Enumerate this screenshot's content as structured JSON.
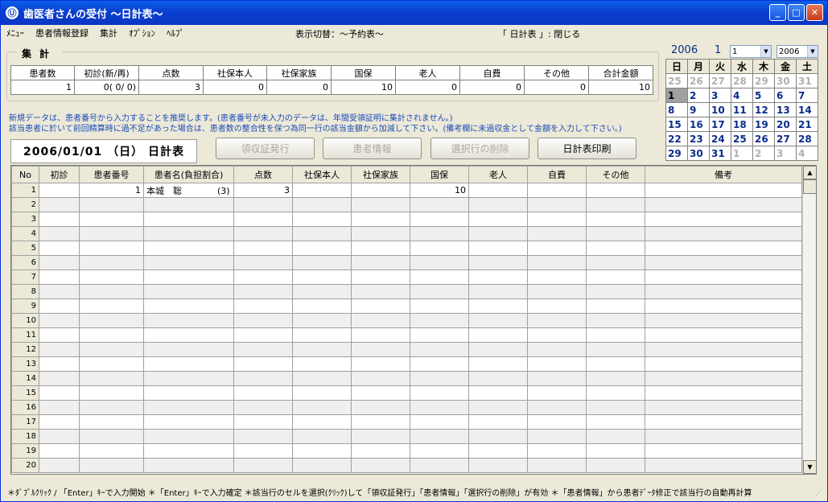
{
  "window": {
    "title": "歯医者さんの受付 ～日計表～",
    "app_icon": "Ⓤ"
  },
  "menu": {
    "items": [
      "ﾒﾆｭｰ",
      "患者情報登録",
      "集計",
      "ｵﾌﾟｼｮﾝ",
      "ﾍﾙﾌﾟ"
    ],
    "view_switch": "表示切替：～予約表～",
    "close_label": "「 日計表 」: 閉じる"
  },
  "summary": {
    "title": "集計",
    "headers": [
      "患者数",
      "初診(新/再)",
      "点数",
      "社保本人",
      "社保家族",
      "国保",
      "老人",
      "自費",
      "その他",
      "合計金額"
    ],
    "values": [
      "1",
      "0(  0/  0)",
      "3",
      "0",
      "0",
      "10",
      "0",
      "0",
      "0",
      "10"
    ]
  },
  "notes": [
    "新規データは、患者番号から入力することを推奨します。(患者番号が未入力のデータは、年間受領証明に集計されません。)",
    "該当患者に於いて前回精算時に過不足があった場合は、患者数の整合性を保つ為同一行の該当金額から加減して下さい。(備考欄に未過収金として金額を入力して下さい。)"
  ],
  "date_label": "2006/01/01 （日） 日計表",
  "buttons": {
    "receipt": "領収証発行",
    "patient_info": "患者情報",
    "delete_row": "選択行の削除",
    "print": "日計表印刷"
  },
  "calendar": {
    "year": "2006",
    "month": "1",
    "month_select": "1",
    "year_select": "2006",
    "weekdays": [
      "日",
      "月",
      "火",
      "水",
      "木",
      "金",
      "土"
    ],
    "weeks": [
      [
        "25",
        "26",
        "27",
        "28",
        "29",
        "30",
        "31"
      ],
      [
        "1",
        "2",
        "3",
        "4",
        "5",
        "6",
        "7"
      ],
      [
        "8",
        "9",
        "10",
        "11",
        "12",
        "13",
        "14"
      ],
      [
        "15",
        "16",
        "17",
        "18",
        "19",
        "20",
        "21"
      ],
      [
        "22",
        "23",
        "24",
        "25",
        "26",
        "27",
        "28"
      ],
      [
        "29",
        "30",
        "31",
        "1",
        "2",
        "3",
        "4"
      ]
    ]
  },
  "grid": {
    "headers": [
      "No",
      "初診",
      "患者番号",
      "患者名(負担割合)",
      "点数",
      "社保本人",
      "社保家族",
      "国保",
      "老人",
      "自費",
      "その他",
      "備考"
    ],
    "rows": [
      [
        "1",
        "",
        "1",
        "本城　聡　　　　(3)",
        "3",
        "",
        "",
        "10",
        "",
        "",
        "",
        ""
      ],
      [
        "2"
      ],
      [
        "3"
      ],
      [
        "4"
      ],
      [
        "5"
      ],
      [
        "6"
      ],
      [
        "7"
      ],
      [
        "8"
      ],
      [
        "9"
      ],
      [
        "10"
      ],
      [
        "11"
      ],
      [
        "12"
      ],
      [
        "13"
      ],
      [
        "14"
      ],
      [
        "15"
      ],
      [
        "16"
      ],
      [
        "17"
      ],
      [
        "18"
      ],
      [
        "19"
      ],
      [
        "20"
      ]
    ]
  },
  "status": "＊ﾀﾞﾌﾞﾙｸﾘｯｸ / 「Enter」ｷｰで入力開始 ＊「Enter」ｷｰで入力確定 ＊該当行のセルを選択(ｸﾘｯｸ)して「領収証発行」「患者情報」「選択行の削除」が有効 ＊「患者情報」から患者ﾃﾞｰﾀ修正で該当行の自動再計算"
}
